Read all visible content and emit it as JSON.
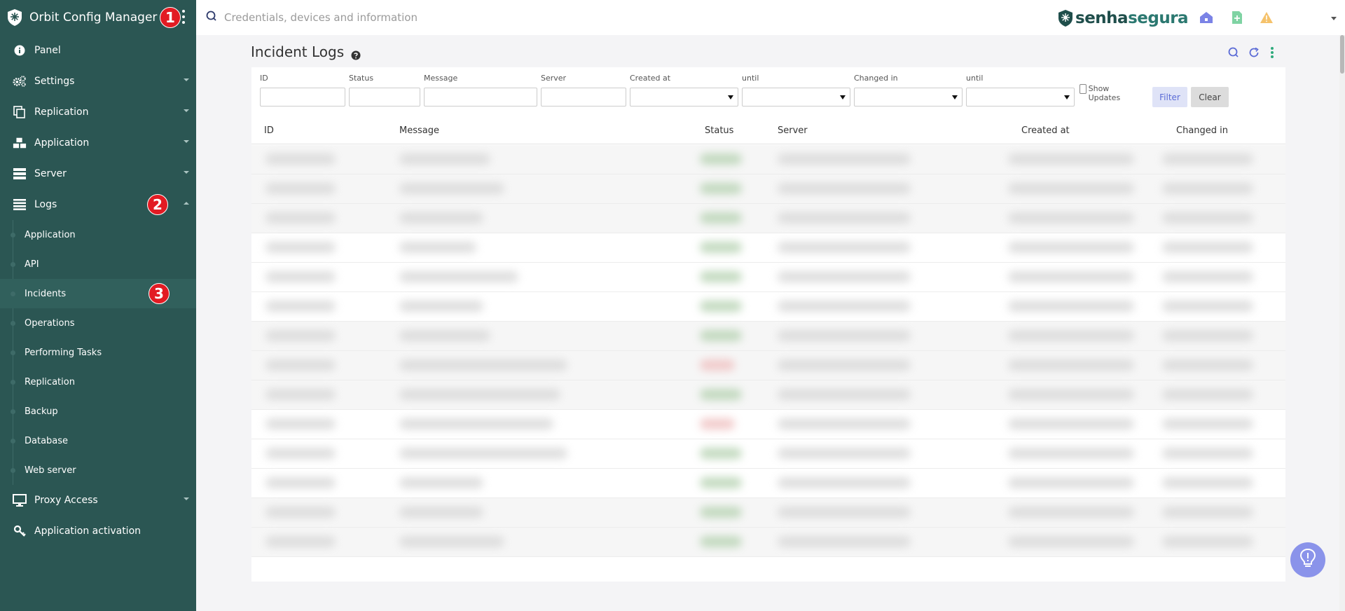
{
  "app": {
    "title": "Orbit Config Manager",
    "accent_color": "#2b5653"
  },
  "badges": {
    "one": "1",
    "two": "2",
    "three": "3"
  },
  "sidebar": {
    "items": [
      {
        "label": "Panel",
        "icon": "info-icon"
      },
      {
        "label": "Settings",
        "icon": "gears-icon"
      },
      {
        "label": "Replication",
        "icon": "copy-icon"
      },
      {
        "label": "Application",
        "icon": "cubes-icon"
      },
      {
        "label": "Server",
        "icon": "server-icon"
      },
      {
        "label": "Logs",
        "icon": "list-icon"
      },
      {
        "label": "Proxy Access",
        "icon": "monitor-icon"
      },
      {
        "label": "Application activation",
        "icon": "key-icon"
      }
    ],
    "logs_sub": [
      {
        "label": "Application"
      },
      {
        "label": "API"
      },
      {
        "label": "Incidents"
      },
      {
        "label": "Operations"
      },
      {
        "label": "Performing Tasks"
      },
      {
        "label": "Replication"
      },
      {
        "label": "Backup"
      },
      {
        "label": "Database"
      },
      {
        "label": "Web server"
      }
    ]
  },
  "topbar": {
    "search_placeholder": "Credentials, devices and information",
    "brand_a": "senha",
    "brand_b": "segura"
  },
  "page": {
    "title": "Incident Logs"
  },
  "filters": {
    "id": "ID",
    "status": "Status",
    "message": "Message",
    "server": "Server",
    "created_at": "Created at",
    "until1": "until",
    "changed_in": "Changed in",
    "until2": "until",
    "show_updates": "Show Updates",
    "filter_button": "Filter",
    "clear_button": "Clear"
  },
  "table": {
    "columns": [
      "ID",
      "Message",
      "Status",
      "Server",
      "Created at",
      "Changed in"
    ]
  }
}
